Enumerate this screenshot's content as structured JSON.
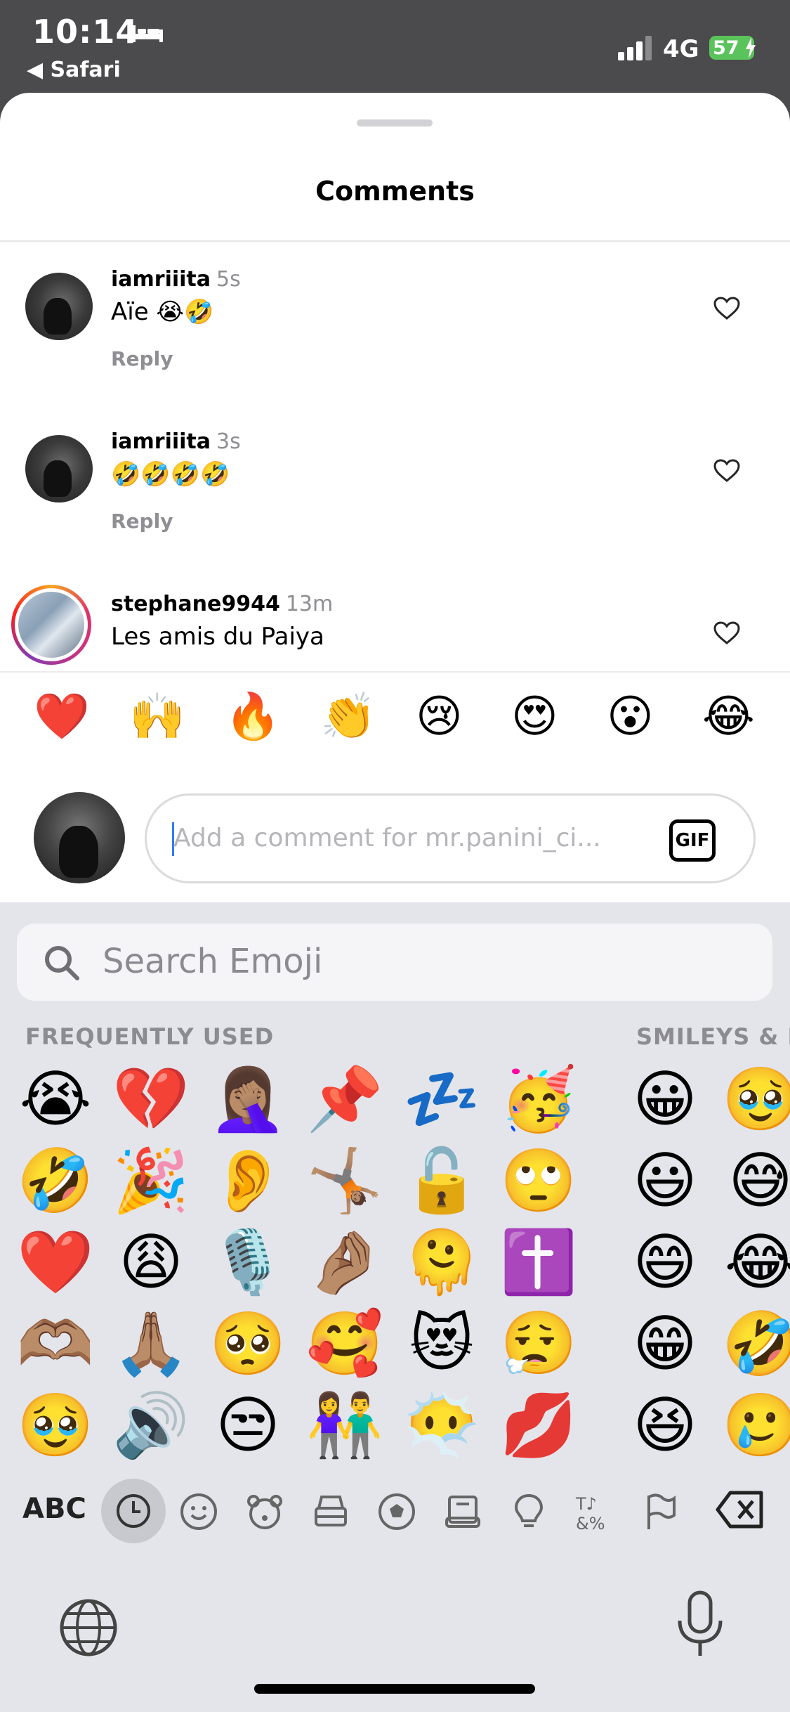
{
  "status": {
    "time": "10:14",
    "back_app": "◀ Safari",
    "network": "4G",
    "battery": "57",
    "icons": [
      "bed-icon",
      "signal-icon",
      "battery-charging-icon"
    ]
  },
  "sheet": {
    "title": "Comments",
    "comments": [
      {
        "user": "iamriiita",
        "ago": "5s",
        "text": "Aïe 😭🤣",
        "reply": "Reply"
      },
      {
        "user": "iamriiita",
        "ago": "3s",
        "text": "🤣🤣🤣🤣",
        "reply": "Reply"
      },
      {
        "user": "stephane9944",
        "ago": "13m",
        "text": "Les amis du Paiya",
        "reply": ""
      }
    ]
  },
  "reactions": [
    "❤️",
    "🙌",
    "🔥",
    "👏",
    "😢",
    "😍",
    "😮",
    "😂"
  ],
  "composer": {
    "placeholder": "Add a comment for mr.panini_ci...",
    "gif_label": "GIF"
  },
  "keyboard": {
    "search_placeholder": "Search Emoji",
    "section_frequent": "FREQUENTLY USED",
    "section_smileys": "SMILEYS & P",
    "frequent": [
      [
        "😭",
        "💔",
        "🤦🏽‍♀️",
        "📌",
        "💤",
        "🥳"
      ],
      [
        "🤣",
        "🎉",
        "👂",
        "🤸🏽",
        "🔓",
        "🙄"
      ],
      [
        "❤️",
        "😩",
        "🎙️",
        "🤌🏽",
        "🫠",
        "✝️"
      ],
      [
        "🫶🏽",
        "🙏🏽",
        "🥺",
        "🥰",
        "😻",
        "😮‍💨"
      ],
      [
        "🥹",
        "🔊",
        "😒",
        "👫",
        "😶‍🌫️",
        "💋"
      ]
    ],
    "smileys": [
      [
        "😀",
        "🥹"
      ],
      [
        "😃",
        "😅"
      ],
      [
        "😄",
        "😂"
      ],
      [
        "😁",
        "🤣"
      ],
      [
        "😆",
        "🥲"
      ]
    ],
    "abc_label": "ABC",
    "categories": [
      "recent-icon",
      "smiley-icon",
      "animal-icon",
      "food-icon",
      "activity-icon",
      "travel-icon",
      "objects-icon",
      "symbols-icon",
      "flags-icon"
    ]
  },
  "colors": {
    "accent": "#3478f6",
    "battery": "#5bc35b",
    "muted": "#8e8e93"
  }
}
